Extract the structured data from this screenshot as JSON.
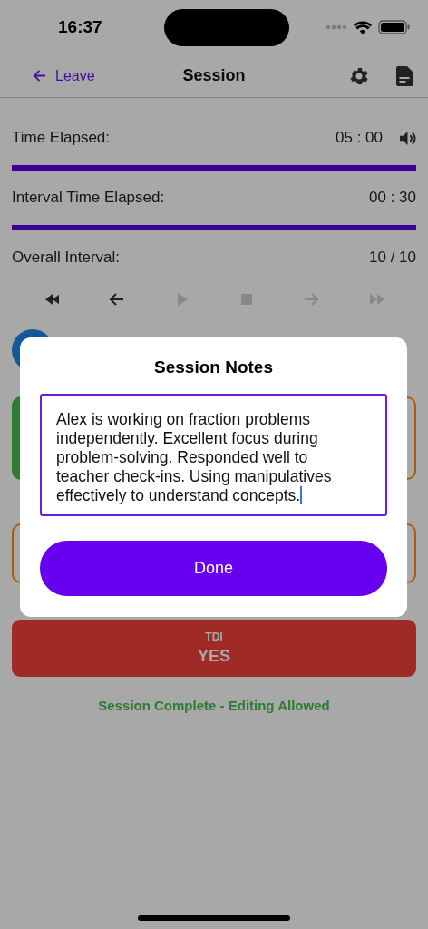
{
  "status_bar": {
    "time": "16:37"
  },
  "nav": {
    "back_label": "Leave",
    "title": "Session"
  },
  "rows": [
    {
      "kind": "reading",
      "label": "Time Elapsed:",
      "value": "05 : 00",
      "sound": true
    },
    {
      "kind": "progress",
      "level": 1
    },
    {
      "kind": "reading",
      "label": "Interval Time Elapsed:",
      "value": "00 : 30",
      "sound": false
    },
    {
      "kind": "progress",
      "level": 1
    },
    {
      "kind": "reading",
      "label": "Overall Interval:",
      "value": "10 / 10",
      "sound": false
    }
  ],
  "controls": [
    {
      "kind": "rewind",
      "disabled": false
    },
    {
      "kind": "back",
      "disabled": false
    },
    {
      "kind": "play",
      "disabled": true
    },
    {
      "kind": "stop",
      "disabled": true
    },
    {
      "kind": "forward",
      "disabled": true
    },
    {
      "kind": "fast_forward",
      "disabled": true
    }
  ],
  "cards": [
    {
      "kind": "filled",
      "color": "#2e7d32"
    },
    {
      "kind": "outlined",
      "color": "#a85e00"
    },
    {
      "kind": "outlined",
      "color": "#a85e00"
    },
    {
      "kind": "outlined",
      "color": "#a85e00"
    }
  ],
  "tdi": {
    "label": "TDI",
    "value": "YES"
  },
  "status_message": "Session Complete - Editing Allowed",
  "modal": {
    "title": "Session Notes",
    "notes": "Alex is working on fraction problems independently. Excellent focus during problem-solving. Responded well to teacher check-ins. Using manipulatives effectively to understand concepts.",
    "button": "Done"
  }
}
